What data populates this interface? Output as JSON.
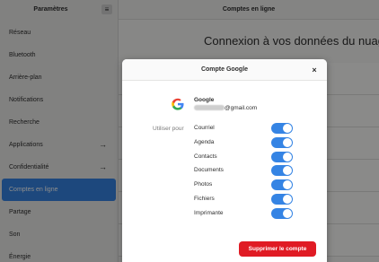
{
  "sidebar": {
    "title": "Paramètres",
    "menu_icon": "hamburger-menu-icon",
    "items": [
      {
        "label": "Réseau",
        "arrow": "",
        "active": false
      },
      {
        "label": "Bluetooth",
        "arrow": "",
        "active": false
      },
      {
        "label": "Arrière-plan",
        "arrow": "",
        "active": false
      },
      {
        "label": "Notifications",
        "arrow": "",
        "active": false
      },
      {
        "label": "Recherche",
        "arrow": "",
        "active": false
      },
      {
        "label": "Applications",
        "arrow": "→",
        "active": true
      },
      {
        "label": "Confidentialité",
        "arrow": "→",
        "active": false
      },
      {
        "label": "Comptes en ligne",
        "arrow": "",
        "active": true
      },
      {
        "label": "Partage",
        "arrow": "",
        "active": false
      },
      {
        "label": "Son",
        "arrow": "",
        "active": false
      },
      {
        "label": "Énergie",
        "arrow": "",
        "active": false
      }
    ]
  },
  "main": {
    "header_title": "Comptes en ligne",
    "heading": "Connexion à vos données du nuage"
  },
  "dialog": {
    "title": "Compte Google",
    "close_glyph": "×",
    "account": {
      "provider": "Google",
      "email_suffix": "@gmail.com"
    },
    "use_for_label": "Utiliser pour",
    "services": [
      {
        "label": "Courriel",
        "enabled": true
      },
      {
        "label": "Agenda",
        "enabled": true
      },
      {
        "label": "Contacts",
        "enabled": true
      },
      {
        "label": "Documents",
        "enabled": true
      },
      {
        "label": "Photos",
        "enabled": true
      },
      {
        "label": "Fichiers",
        "enabled": true
      },
      {
        "label": "Imprimante",
        "enabled": true
      }
    ],
    "remove_button": "Supprimer le compte"
  },
  "colors": {
    "accent": "#3584e4",
    "destructive": "#e01b24"
  }
}
